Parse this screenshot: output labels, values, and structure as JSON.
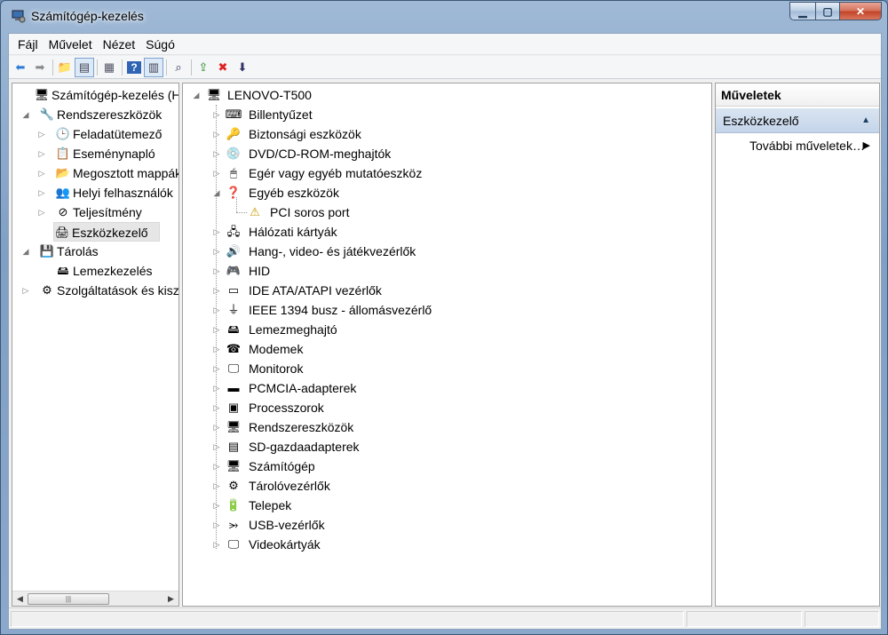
{
  "window": {
    "title": "Számítógép-kezelés"
  },
  "menubar": [
    "Fájl",
    "Művelet",
    "Nézet",
    "Súgó"
  ],
  "toolbar": [
    {
      "name": "back-icon",
      "glyph": "⬅",
      "color": "#2b7bd6"
    },
    {
      "name": "forward-icon",
      "glyph": "➡",
      "color": "#888"
    },
    {
      "sep": true
    },
    {
      "name": "up-folder-icon",
      "glyph": "📁",
      "color": "#c99a2e"
    },
    {
      "name": "show-hide-tree-icon",
      "glyph": "▤",
      "color": "#445",
      "active": true
    },
    {
      "sep": true
    },
    {
      "name": "properties-icon",
      "glyph": "▦",
      "color": "#556"
    },
    {
      "sep": true
    },
    {
      "name": "help-icon",
      "glyph": "?",
      "color": "#fff",
      "bg": "#2f64b5"
    },
    {
      "name": "show-action-pane-icon",
      "glyph": "▥",
      "color": "#445",
      "active": true
    },
    {
      "sep": true
    },
    {
      "name": "scan-hardware-icon",
      "glyph": "⌕",
      "color": "#335"
    },
    {
      "sep": true
    },
    {
      "name": "update-driver-icon",
      "glyph": "⇪",
      "color": "#2a8a2a"
    },
    {
      "name": "uninstall-icon",
      "glyph": "✖",
      "color": "#d22"
    },
    {
      "name": "enable-device-icon",
      "glyph": "⬇",
      "color": "#336"
    }
  ],
  "left_tree": [
    {
      "label": "Számítógép-kezelés (Helyi)",
      "level": 0,
      "expander": "",
      "icon": "computer-management-icon",
      "glyph": "🖥"
    },
    {
      "label": "Rendszereszközök",
      "level": 1,
      "expander": "◢",
      "icon": "system-tools-icon",
      "glyph": "🔧"
    },
    {
      "label": "Feladatütemező",
      "level": 2,
      "expander": "▷",
      "icon": "task-scheduler-icon",
      "glyph": "🕒"
    },
    {
      "label": "Eseménynapló",
      "level": 2,
      "expander": "▷",
      "icon": "event-viewer-icon",
      "glyph": "📋"
    },
    {
      "label": "Megosztott mappák",
      "level": 2,
      "expander": "▷",
      "icon": "shared-folders-icon",
      "glyph": "📂"
    },
    {
      "label": "Helyi felhasználók",
      "level": 2,
      "expander": "▷",
      "icon": "local-users-icon",
      "glyph": "👥"
    },
    {
      "label": "Teljesítmény",
      "level": 2,
      "expander": "▷",
      "icon": "performance-icon",
      "glyph": "⊘"
    },
    {
      "label": "Eszközkezelő",
      "level": 2,
      "expander": "",
      "icon": "device-manager-icon",
      "glyph": "🖨",
      "selected": true
    },
    {
      "label": "Tárolás",
      "level": 1,
      "expander": "◢",
      "icon": "storage-icon",
      "glyph": "💾"
    },
    {
      "label": "Lemezkezelés",
      "level": 2,
      "expander": "",
      "icon": "disk-management-icon",
      "glyph": "🖴"
    },
    {
      "label": "Szolgáltatások és kiszolgálóalkalmazások",
      "level": 1,
      "expander": "▷",
      "icon": "services-icon",
      "glyph": "⚙"
    }
  ],
  "device_tree": {
    "root": {
      "label": "LENOVO-T500",
      "icon": "computer-icon",
      "glyph": "🖥"
    },
    "items": [
      {
        "label": "Billentyűzet",
        "icon": "keyboard-icon",
        "glyph": "⌨",
        "expander": "▷"
      },
      {
        "label": "Biztonsági eszközök",
        "icon": "security-devices-icon",
        "glyph": "🔑",
        "expander": "▷"
      },
      {
        "label": "DVD/CD-ROM-meghajtók",
        "icon": "dvd-drive-icon",
        "glyph": "💿",
        "expander": "▷"
      },
      {
        "label": "Egér vagy egyéb mutatóeszköz",
        "icon": "mouse-icon",
        "glyph": "🖱",
        "expander": "▷"
      },
      {
        "label": "Egyéb eszközök",
        "icon": "other-devices-icon",
        "glyph": "❓",
        "expander": "◢"
      },
      {
        "label": "PCI soros port",
        "icon": "warning-device-icon",
        "glyph": "⚠",
        "expander": "",
        "child": true
      },
      {
        "label": "Hálózati kártyák",
        "icon": "network-adapter-icon",
        "glyph": "🖧",
        "expander": "▷"
      },
      {
        "label": "Hang-, video- és játékvezérlők",
        "icon": "sound-video-icon",
        "glyph": "🔊",
        "expander": "▷"
      },
      {
        "label": "HID",
        "icon": "hid-icon",
        "glyph": "🎮",
        "expander": "▷"
      },
      {
        "label": "IDE ATA/ATAPI vezérlők",
        "icon": "ide-controller-icon",
        "glyph": "▭",
        "expander": "▷"
      },
      {
        "label": "IEEE 1394 busz - állomásvezérlő",
        "icon": "ieee1394-icon",
        "glyph": "⏚",
        "expander": "▷"
      },
      {
        "label": "Lemezmeghajtó",
        "icon": "disk-drive-icon",
        "glyph": "🖴",
        "expander": "▷"
      },
      {
        "label": "Modemek",
        "icon": "modem-icon",
        "glyph": "☎",
        "expander": "▷"
      },
      {
        "label": "Monitorok",
        "icon": "monitor-icon",
        "glyph": "🖵",
        "expander": "▷"
      },
      {
        "label": "PCMCIA-adapterek",
        "icon": "pcmcia-icon",
        "glyph": "▬",
        "expander": "▷"
      },
      {
        "label": "Processzorok",
        "icon": "processor-icon",
        "glyph": "▣",
        "expander": "▷"
      },
      {
        "label": "Rendszereszközök",
        "icon": "system-devices-icon",
        "glyph": "🖥",
        "expander": "▷"
      },
      {
        "label": "SD-gazdaadapterek",
        "icon": "sd-host-icon",
        "glyph": "▤",
        "expander": "▷"
      },
      {
        "label": "Számítógép",
        "icon": "computer-small-icon",
        "glyph": "🖥",
        "expander": "▷"
      },
      {
        "label": "Tárolóvezérlők",
        "icon": "storage-controller-icon",
        "glyph": "⚙",
        "expander": "▷"
      },
      {
        "label": "Telepek",
        "icon": "battery-icon",
        "glyph": "🔋",
        "expander": "▷"
      },
      {
        "label": "USB-vezérlők",
        "icon": "usb-icon",
        "glyph": "⭃",
        "expander": "▷"
      },
      {
        "label": "Videokártyák",
        "icon": "display-adapter-icon",
        "glyph": "🖵",
        "expander": "▷"
      }
    ]
  },
  "actions": {
    "header": "Műveletek",
    "section": "Eszközkezelő",
    "more": "További műveletek"
  },
  "colors": {
    "accent": "#c4d5ea",
    "selection": "#e6e6e6"
  }
}
